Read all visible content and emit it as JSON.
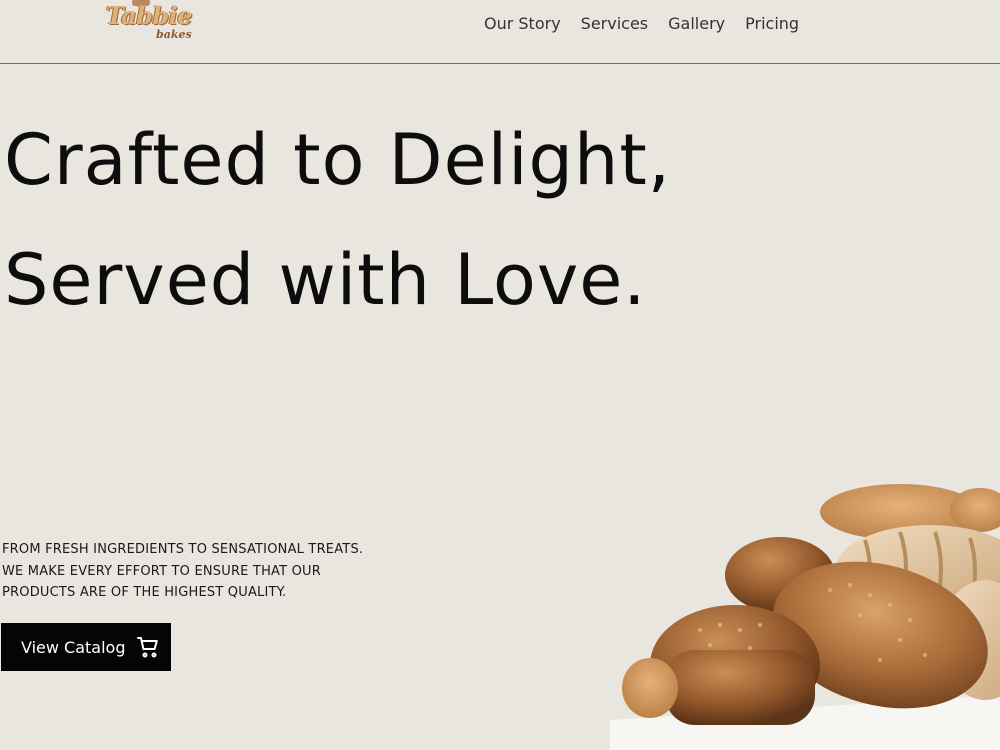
{
  "brand": {
    "logo_main": "Tabbie",
    "logo_sub": "bakes"
  },
  "nav": {
    "items": [
      {
        "label": "Our Story"
      },
      {
        "label": "Services"
      },
      {
        "label": "Gallery"
      },
      {
        "label": "Pricing"
      }
    ]
  },
  "hero": {
    "headline_line1": "Crafted to Delight,",
    "headline_line2": "Served with Love.",
    "tagline_line1": "FROM FRESH INGREDIENTS TO SENSATIONAL TREATS.",
    "tagline_line2": "WE MAKE EVERY EFFORT TO ENSURE THAT OUR",
    "tagline_line3": "PRODUCTS ARE OF THE HIGHEST QUALITY.",
    "cta_label": "View Catalog",
    "cta_icon": "cart-icon"
  },
  "colors": {
    "background": "#e9e5df",
    "cta_background": "#050505",
    "logo_gold": "#e0b27a",
    "logo_brown": "#8a5a2f"
  }
}
